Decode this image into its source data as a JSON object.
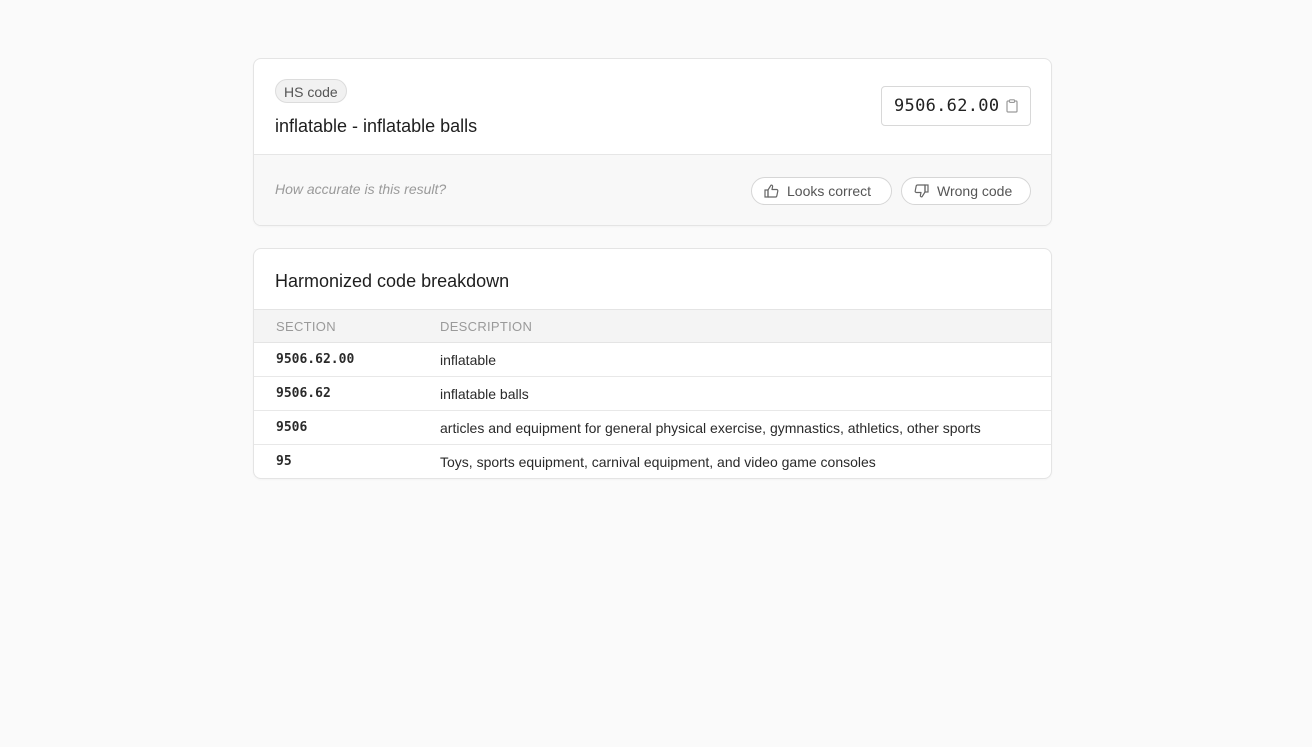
{
  "result": {
    "chip_label": "HS code",
    "title": "inflatable - inflatable balls",
    "code": "9506.62.00",
    "copy_icon": "clipboard-icon"
  },
  "feedback": {
    "question": "How accurate is this result?",
    "correct_label": "Looks correct",
    "correct_icon": "thumbs-up-icon",
    "wrong_label": "Wrong code",
    "wrong_icon": "thumbs-down-icon"
  },
  "breakdown": {
    "title": "Harmonized code breakdown",
    "columns": [
      "SECTION",
      "DESCRIPTION"
    ],
    "rows": [
      {
        "section": "9506.62.00",
        "description": "inflatable"
      },
      {
        "section": "9506.62",
        "description": "inflatable balls"
      },
      {
        "section": "9506",
        "description": "articles and equipment for general physical exercise, gymnastics, athletics, other sports"
      },
      {
        "section": "95",
        "description": "Toys, sports equipment, carnival equipment, and video game consoles"
      }
    ]
  },
  "colors": {
    "background": "#fafafa",
    "card": "#ffffff",
    "border": "#e4e4e4",
    "muted_text": "#9a9a9a"
  }
}
